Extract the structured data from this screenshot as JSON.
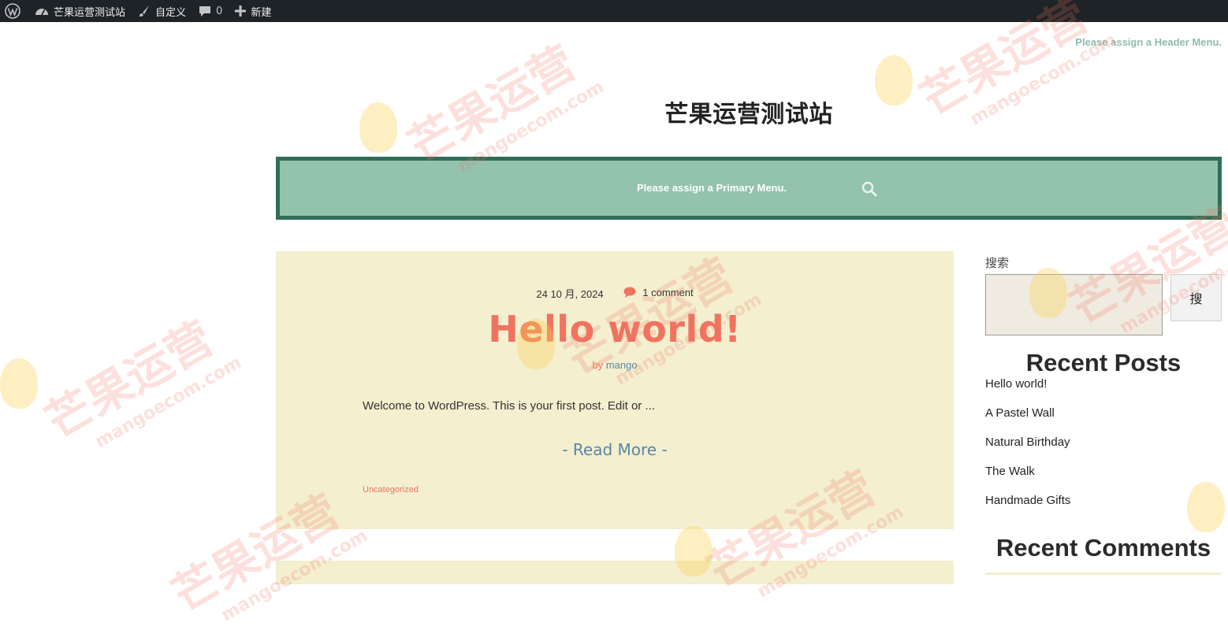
{
  "admin_bar": {
    "site_name": "芒果运营测试站",
    "customize": "自定义",
    "comments_count": "0",
    "new": "新建"
  },
  "header": {
    "header_menu_notice": "Please assign a Header Menu.",
    "site_title": "芒果运营测试站",
    "primary_menu_notice": "Please assign a Primary Menu."
  },
  "post": {
    "date": "24 10 月, 2024",
    "comments": "1 comment",
    "title": "Hello world!",
    "by": "by",
    "author": "mango",
    "excerpt": "Welcome to WordPress. This is your first post. Edit or ...",
    "read_more": "- Read More -",
    "category": "Uncategorized"
  },
  "sidebar": {
    "search_label": "搜索",
    "search_value": "",
    "search_button": "搜",
    "recent_posts_title": "Recent Posts",
    "recent_posts": [
      "Hello world!",
      "A Pastel Wall",
      "Natural Birthday",
      "The Walk",
      "Handmade Gifts"
    ],
    "recent_comments_title": "Recent Comments"
  },
  "watermark": {
    "cn": "芒果运营",
    "en": "mangoecom.com"
  },
  "colors": {
    "admin_bar": "#1d2327",
    "nav_background": "#93c2ad",
    "nav_border": "#2f6e58",
    "card_background": "#f3efcf",
    "title_coral": "#f07360",
    "link_blue": "#5b86a6"
  }
}
